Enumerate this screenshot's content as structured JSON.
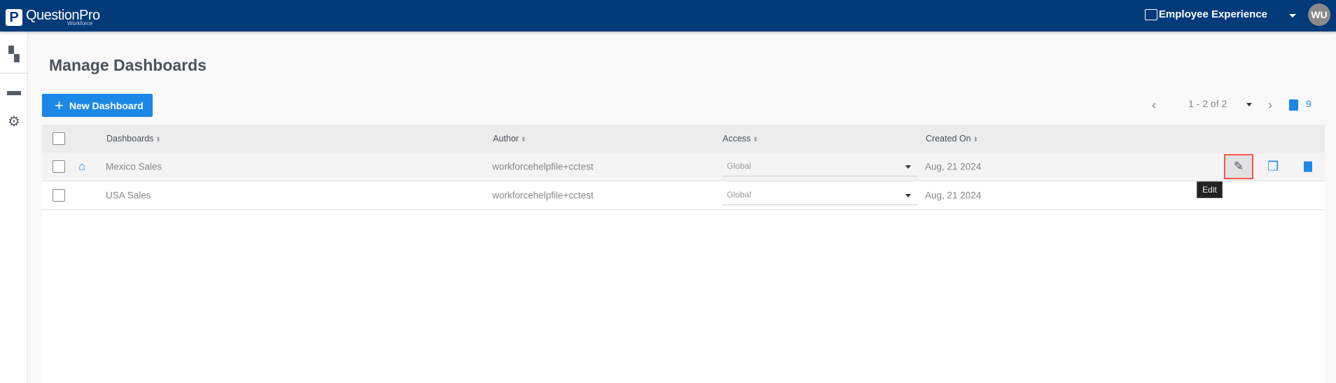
{
  "topbar": {
    "brand": "QuestionPro",
    "brand_sub": "Workforce",
    "logo": "P",
    "app_name": "Employee Experience",
    "avatar": "WU"
  },
  "sidebar": {
    "items": [
      "dashboard-icon",
      "folder-icon",
      "gear-icon"
    ]
  },
  "page": {
    "title": "Manage Dashboards",
    "new_button": "New Dashboard"
  },
  "pagination": {
    "range": "1 - 2 of 2",
    "trash_count": "9"
  },
  "table": {
    "headers": {
      "dashboards": "Dashboards",
      "author": "Author",
      "access": "Access",
      "created": "Created On"
    },
    "rows": [
      {
        "name": "Mexico Sales",
        "home": true,
        "author": "workforcehelpfile+cctest",
        "access": "Global",
        "created": "Aug, 21 2024"
      },
      {
        "name": "USA Sales",
        "home": false,
        "author": "workforcehelpfile+cctest",
        "access": "Global",
        "created": "Aug, 21 2024"
      }
    ]
  },
  "tooltip": "Edit",
  "colors": {
    "header": "#003a79",
    "accent": "#1b87e6",
    "highlight": "#f25a4a"
  }
}
